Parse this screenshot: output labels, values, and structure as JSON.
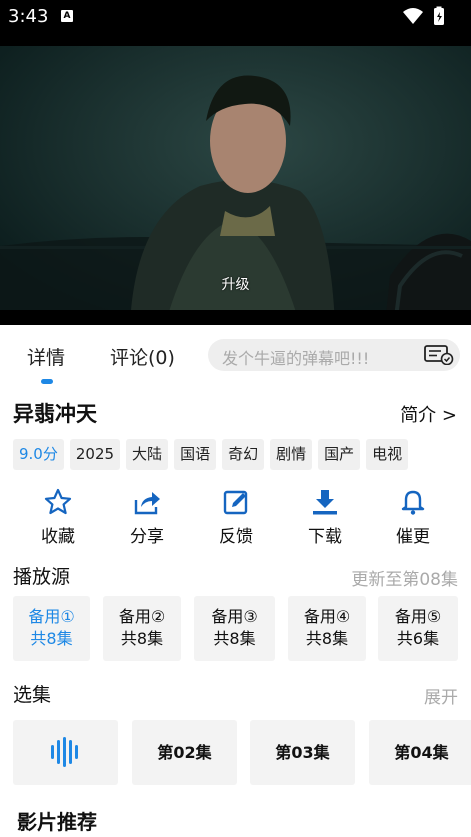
{
  "status_bar": {
    "time": "3:43",
    "a_icon": "A",
    "icons": [
      "wifi-icon",
      "battery-icon"
    ]
  },
  "video": {
    "subtitle": "升级"
  },
  "tabs": {
    "detail": "详情",
    "comments": "评论(0)"
  },
  "danmu": {
    "placeholder": "发个牛逼的弹幕吧!!!"
  },
  "show": {
    "title": "异翡冲天",
    "intro_link": "简介 >",
    "tags": [
      "9.0分",
      "2025",
      "大陆",
      "国语",
      "奇幻",
      "剧情",
      "国产",
      "电视"
    ]
  },
  "actions": [
    {
      "label": "收藏",
      "icon": "star-icon"
    },
    {
      "label": "分享",
      "icon": "share-icon"
    },
    {
      "label": "反馈",
      "icon": "edit-icon"
    },
    {
      "label": "下载",
      "icon": "download-icon"
    },
    {
      "label": "催更",
      "icon": "bell-icon"
    }
  ],
  "sources_section": {
    "title": "播放源",
    "update_info": "更新至第08集",
    "items": [
      {
        "name": "备用①",
        "count": "共8集"
      },
      {
        "name": "备用②",
        "count": "共8集"
      },
      {
        "name": "备用③",
        "count": "共8集"
      },
      {
        "name": "备用④",
        "count": "共8集"
      },
      {
        "name": "备用⑤",
        "count": "共6集"
      }
    ]
  },
  "episodes_section": {
    "title": "选集",
    "expand": "展开",
    "items": [
      "第02集",
      "第03集",
      "第04集"
    ]
  },
  "recommend": {
    "title": "影片推荐"
  },
  "colors": {
    "accent": "#1e88e5",
    "tag_bg": "#f0f0f0",
    "card_bg": "#f3f3f3"
  }
}
